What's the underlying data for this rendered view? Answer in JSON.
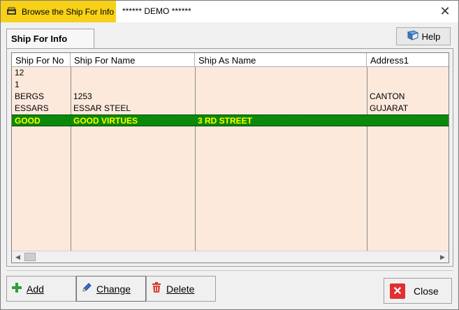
{
  "window": {
    "title": "Browse the Ship For Info",
    "demo_label": "****** DEMO ******",
    "close_glyph": "✕"
  },
  "tab": {
    "label": "Ship For Info"
  },
  "help": {
    "label": "Help"
  },
  "grid": {
    "columns": [
      "Ship For No",
      "Ship For Name",
      "Ship As Name",
      "Address1"
    ],
    "rows": [
      [
        "12",
        "",
        "",
        ""
      ],
      [
        "1",
        "",
        "",
        ""
      ],
      [
        "BERGS",
        "1253",
        "",
        "CANTON"
      ],
      [
        "ESSARS",
        "ESSAR STEEL",
        "",
        "GUJARAT"
      ],
      [
        "GOOD",
        "GOOD VIRTUES",
        "3 RD STREET",
        ""
      ]
    ],
    "selected_row_index": 4
  },
  "buttons": {
    "add": "Add",
    "change": "Change",
    "delete": "Delete",
    "close": "Close"
  },
  "colors": {
    "title_tab": "#f7d117",
    "grid_bg": "#fde9dc",
    "selected_bg": "#0a8a0a",
    "selected_text": "#ffff00"
  }
}
